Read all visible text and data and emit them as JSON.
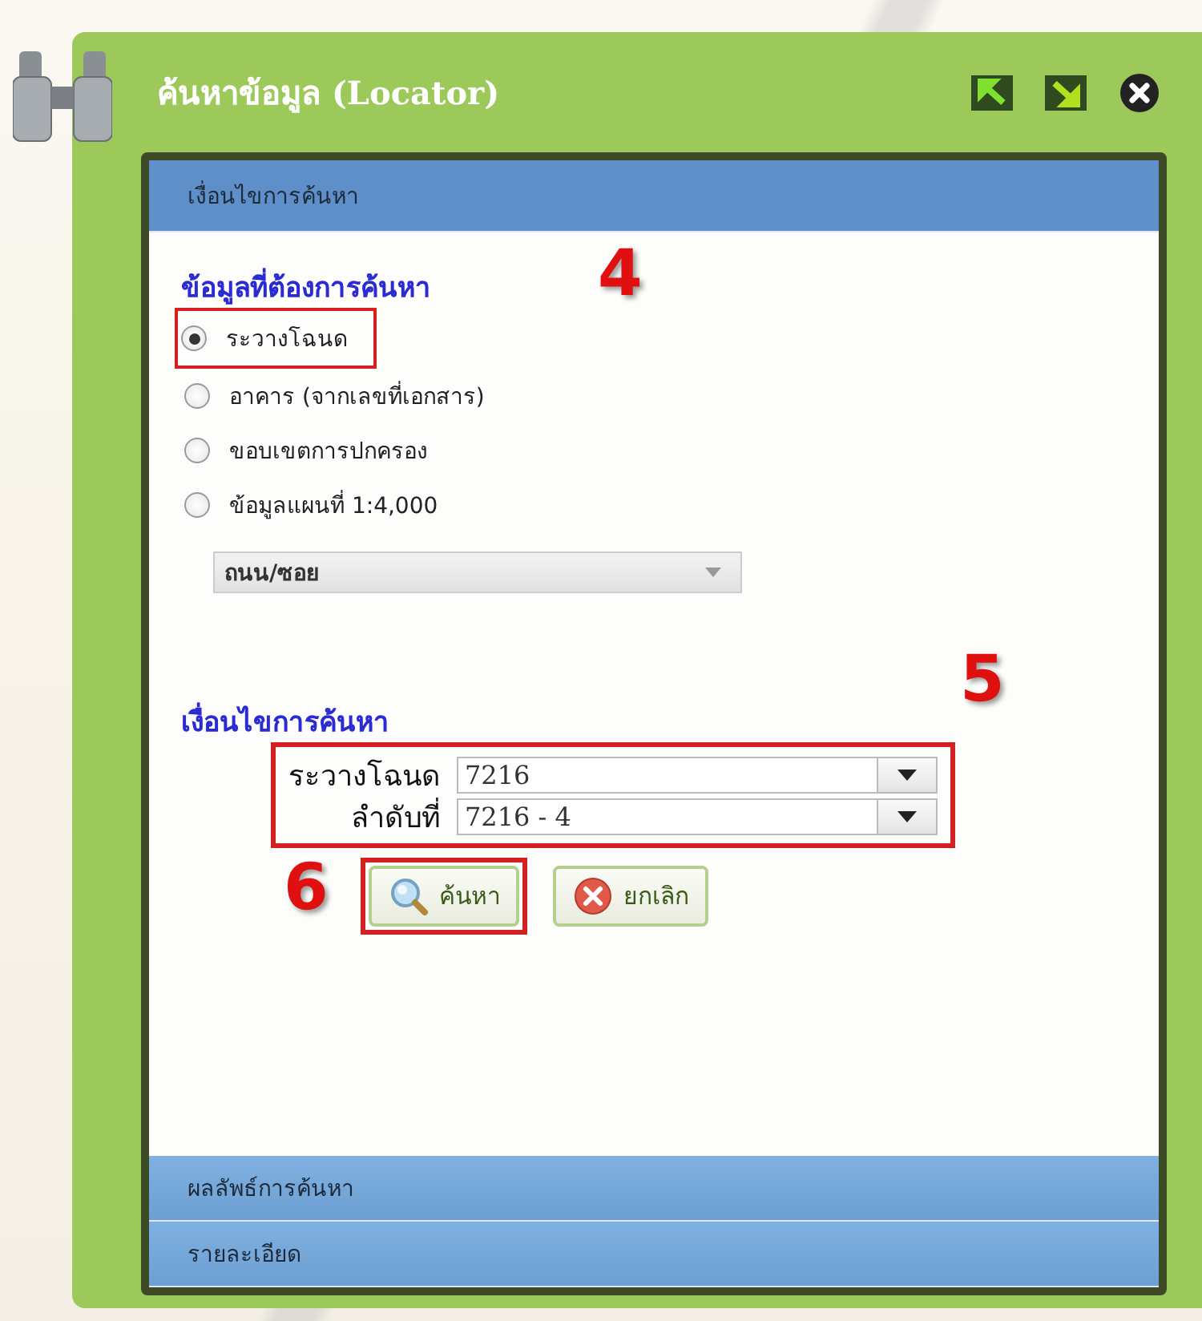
{
  "window": {
    "title": "ค้นหาข้อมูล (Locator)"
  },
  "sections": [
    {
      "label": "เงื่อนไขการค้นหา",
      "expanded": true
    },
    {
      "label": "ผลลัพธ์การค้นหา",
      "expanded": false
    },
    {
      "label": "รายละเอียด",
      "expanded": false
    }
  ],
  "search_target": {
    "heading": "ข้อมูลที่ต้องการค้นหา",
    "options": [
      {
        "label": "ระวางโฉนด",
        "selected": true
      },
      {
        "label": "อาคาร (จากเลขที่เอกสาร)",
        "selected": false
      },
      {
        "label": "ขอบเขตการปกครอง",
        "selected": false
      },
      {
        "label": "ข้อมูลแผนที่ 1:4,000",
        "selected": false
      }
    ],
    "layer_select": {
      "value": "ถนน/ซอย",
      "disabled": true
    }
  },
  "conditions": {
    "heading": "เงื่อนไขการค้นหา",
    "fields": [
      {
        "label": "ระวางโฉนด",
        "value": "7216"
      },
      {
        "label": "ลำดับที่",
        "value": "7216 - 4"
      }
    ]
  },
  "buttons": [
    {
      "label": "ค้นหา",
      "kind": "search"
    },
    {
      "label": "ยกเลิก",
      "kind": "cancel"
    }
  ],
  "annotations": [
    {
      "number": "4"
    },
    {
      "number": "5"
    },
    {
      "number": "6"
    }
  ]
}
